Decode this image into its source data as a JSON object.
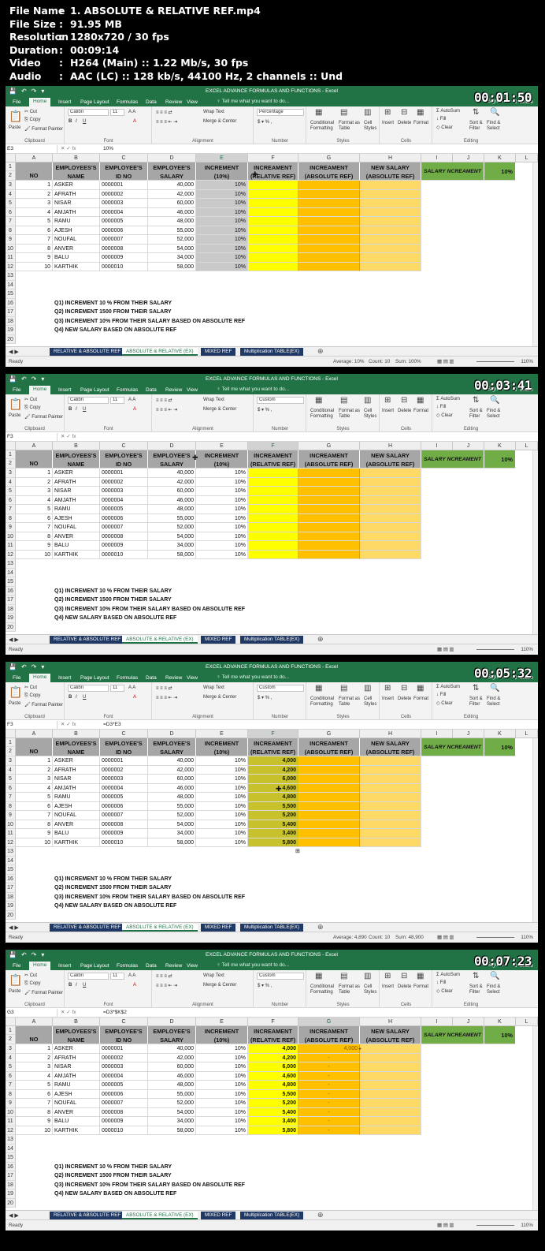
{
  "header": {
    "rows": [
      {
        "key": "File Name",
        "value": "1. ABSOLUTE & RELATIVE REF.mp4"
      },
      {
        "key": "File Size",
        "value": "91.95 MB"
      },
      {
        "key": "Resolution",
        "value": "1280x720 / 30 fps"
      },
      {
        "key": "Duration",
        "value": "00:09:14"
      },
      {
        "key": "Video",
        "value": "H264 (Main) :: 1.22 Mb/s, 30 fps"
      },
      {
        "key": "Audio",
        "value": "AAC (LC) :: 128 kb/s, 44100 Hz, 2 channels :: Und"
      }
    ],
    "colon": ":"
  },
  "excel": {
    "title": "EXCEL ADVANCE FORMULAS AND FUNCTIONS - Excel",
    "qat": [
      "💾",
      "↶",
      "↷",
      "▾"
    ],
    "menu": [
      "File",
      "Home",
      "Insert",
      "Page Layout",
      "Formulas",
      "Data",
      "Review",
      "View"
    ],
    "tell_me": "♀ Tell me what you want to do...",
    "sign_in": "Sign in",
    "share": "⇪ Share",
    "clipboard": {
      "paste": "Paste",
      "cut": "✂ Cut",
      "copy": "⎘ Copy",
      "format_painter": "🖌 Format Painter",
      "label": "Clipboard"
    },
    "font": {
      "name": "Calibri",
      "size": "11",
      "grow": "A A",
      "bold": "B",
      "italic": "I",
      "underline": "U",
      "label": "Font"
    },
    "alignment": {
      "wrap": "Wrap Text",
      "merge": "Merge & Center",
      "label": "Alignment"
    },
    "number": {
      "pct": "%",
      "comma": ",",
      "dollar": "$",
      "label": "Number"
    },
    "styles": {
      "cond": "Conditional\nFormatting",
      "table": "Format as\nTable",
      "cell": "Cell\nStyles",
      "label": "Styles"
    },
    "cells": {
      "insert": "Insert",
      "delete": "Delete",
      "format": "Format",
      "label": "Cells"
    },
    "editing": {
      "autosum": "Σ AutoSum",
      "fill": "↓ Fill",
      "clear": "◇ Clear",
      "sort": "Sort &\nFilter",
      "find": "Find &\nSelect",
      "label": "Editing"
    },
    "fx": "fx",
    "cols": [
      "A",
      "B",
      "C",
      "D",
      "E",
      "F",
      "G",
      "H",
      "I",
      "J",
      "K",
      "L"
    ],
    "headers": {
      "A": "NO",
      "B": "EMPLOYEES'S NAME",
      "C": "EMPLOYEE'S ID NO",
      "D": "EMPLOYEE'S SALARY",
      "E": "INCREMENT (10%)",
      "F": "INCREAMENT (RELATIVE REF)",
      "G": "INCREAMENT (ABSOLUTE REF)",
      "H": "NEW SALARY (ABSOLUTE REF)",
      "I": "SALARY NCREAMENT",
      "K": "10%"
    },
    "rows": [
      {
        "no": "1",
        "name": "ASKER",
        "id": "0000001",
        "salary": "40,000",
        "pct": "10%",
        "rel": "4,000"
      },
      {
        "no": "2",
        "name": "AFRATH",
        "id": "0000002",
        "salary": "42,000",
        "pct": "10%",
        "rel": "4,200"
      },
      {
        "no": "3",
        "name": "NISAR",
        "id": "0000003",
        "salary": "60,000",
        "pct": "10%",
        "rel": "6,000"
      },
      {
        "no": "4",
        "name": "AMJATH",
        "id": "0000004",
        "salary": "46,000",
        "pct": "10%",
        "rel": "4,600"
      },
      {
        "no": "5",
        "name": "RAMU",
        "id": "0000005",
        "salary": "48,000",
        "pct": "10%",
        "rel": "4,800"
      },
      {
        "no": "6",
        "name": "AJESH",
        "id": "0000006",
        "salary": "55,000",
        "pct": "10%",
        "rel": "5,500"
      },
      {
        "no": "7",
        "name": "NOUFAL",
        "id": "0000007",
        "salary": "52,000",
        "pct": "10%",
        "rel": "5,200"
      },
      {
        "no": "8",
        "name": "ANVER",
        "id": "0000008",
        "salary": "54,000",
        "pct": "10%",
        "rel": "5,400"
      },
      {
        "no": "9",
        "name": "BALU",
        "id": "0000009",
        "salary": "34,000",
        "pct": "10%",
        "rel": "3,400"
      },
      {
        "no": "10",
        "name": "KARTHIK",
        "id": "0000010",
        "salary": "58,000",
        "pct": "10%",
        "rel": "5,800"
      }
    ],
    "notes": [
      "Q1) INCREMENT 10 % FROM THEIR SALARY",
      "Q2) INCREMENT 1500  FROM THEIR SALARY",
      "Q3) INCREMENT 10%   FROM THEIR SALARY BASED ON ABSOLUTE REF",
      "Q4) NEW SALARY  BASED ON ABSOLUTE REF"
    ],
    "sheets": [
      "RELATIVE & ABSOLUTE REF",
      "ABSOLUTE & RELATIVE (EX)",
      "MIXED REF",
      "Multiplication TABLE(EX)"
    ],
    "add_sheet": "⊕",
    "ready": "Ready",
    "g_first": "4,000",
    "g_dash": "-"
  },
  "frames": [
    {
      "ts": "00:01:50",
      "namebox": "E3",
      "formula": "10%",
      "numfmt": "Percentage",
      "sel": "E",
      "show_rel": false,
      "show_abs": false,
      "sum": {
        "avg": "Average: 10%",
        "count": "Count: 10",
        "total": "Sum: 100%"
      },
      "zoom": "110%"
    },
    {
      "ts": "00:03:41",
      "namebox": "F3",
      "formula": "",
      "numfmt": "Custom",
      "sel": "F",
      "show_rel": false,
      "show_abs": false,
      "sum": null,
      "zoom": "110%"
    },
    {
      "ts": "00:05:32",
      "namebox": "F3",
      "formula": "=D3*E3",
      "numfmt": "Custom",
      "sel": "F",
      "show_rel": true,
      "show_abs": false,
      "sum": {
        "avg": "Average: 4,890",
        "count": "Count: 10",
        "total": "Sum: 48,900"
      },
      "zoom": "110%"
    },
    {
      "ts": "00:07:23",
      "namebox": "G3",
      "formula": "=D3*$K$2",
      "numfmt": "Custom",
      "sel": "G",
      "show_rel": true,
      "show_abs": true,
      "sum": null,
      "zoom": "110%"
    }
  ]
}
